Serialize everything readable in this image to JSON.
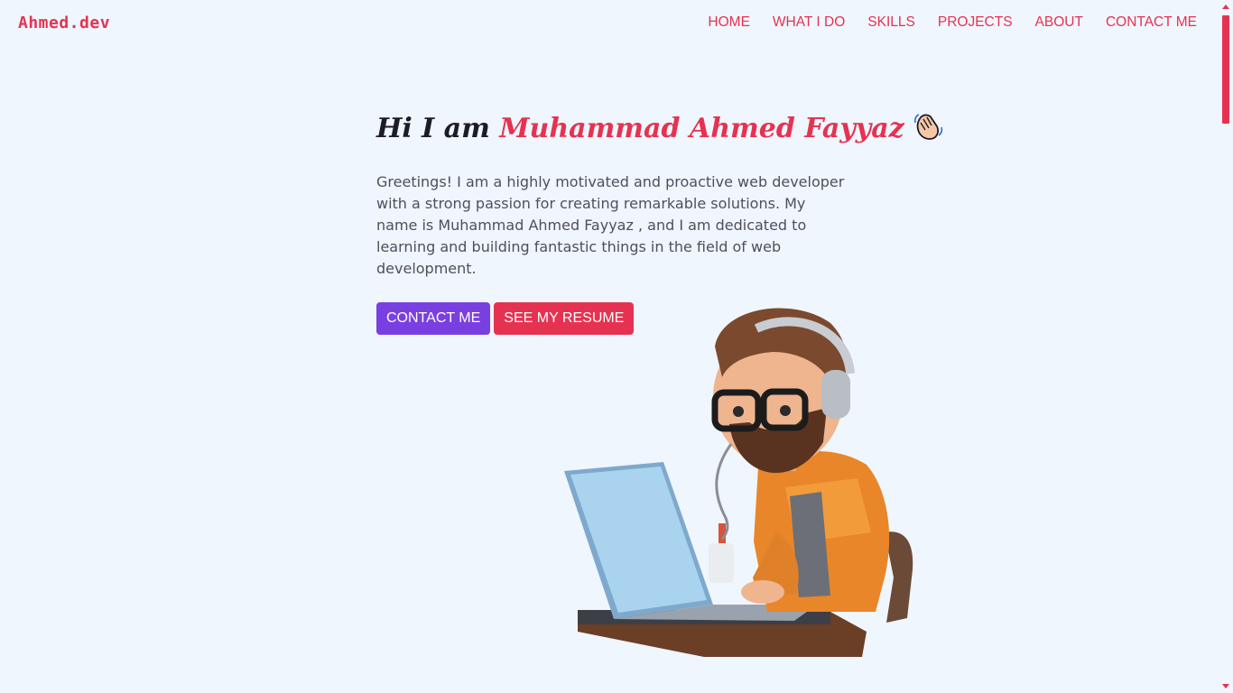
{
  "logo": "Ahmed.dev",
  "nav": {
    "home": "HOME",
    "what_i_do": "WHAT I DO",
    "skills": "SKILLS",
    "projects": "PROJECTS",
    "about": "ABOUT",
    "contact": "CONTACT ME"
  },
  "hero": {
    "greeting": "Hi I am ",
    "name": "Muhammad Ahmed Fayyaz",
    "description": "Greetings! I am a highly motivated and proactive web developer with a strong passion for creating remarkable solutions. My name is Muhammad Ahmed Fayyaz , and I am dedicated to learning and building fantastic things in the field of web development.",
    "contact_button": "CONTACT ME",
    "resume_button": "SEE MY RESUME"
  },
  "colors": {
    "accent": "#e63251",
    "primary_button": "#7a3fe0",
    "background": "#eff6fd"
  },
  "icons": {
    "wave": "waving-hand-icon",
    "illustration": "developer-avatar-illustration"
  }
}
